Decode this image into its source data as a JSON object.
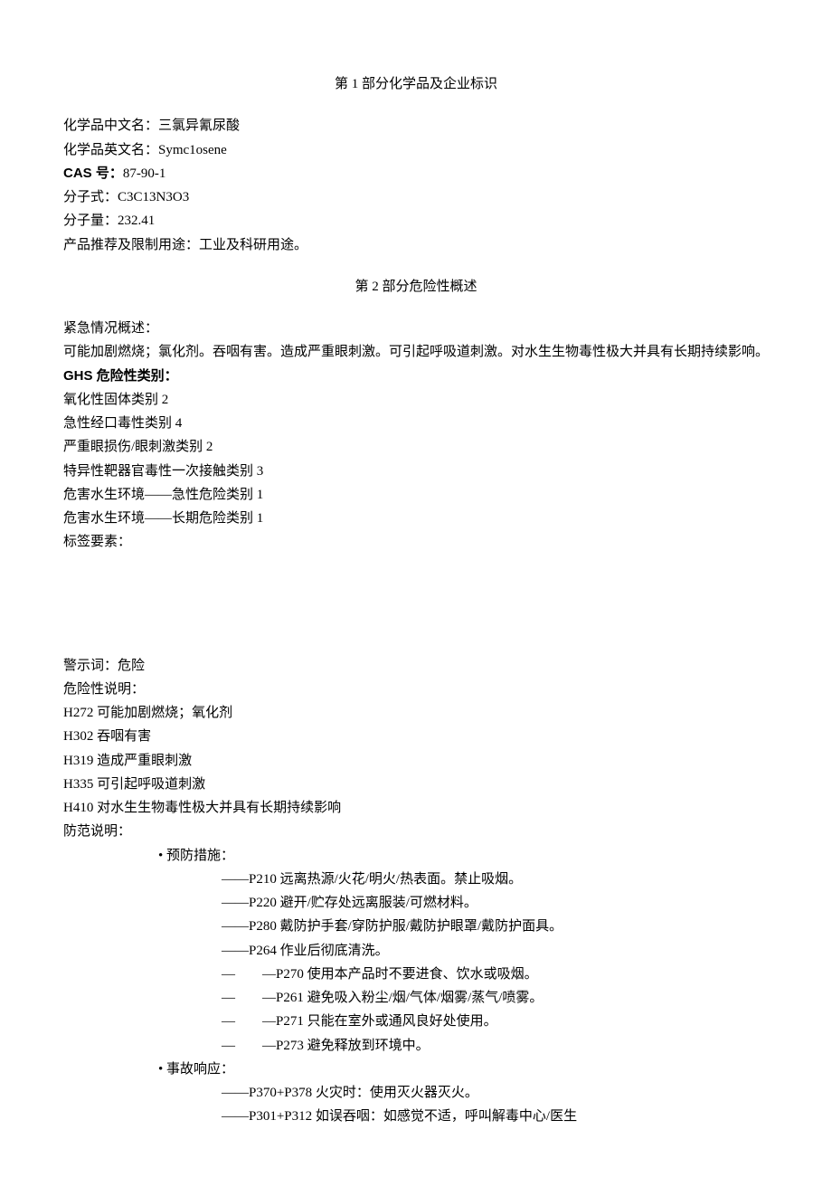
{
  "section1": {
    "header": "第 1 部分化学品及企业标识",
    "rows": [
      {
        "label": "化学品中文名：",
        "value": "三氯异氰尿酸"
      },
      {
        "label": "化学品英文名：",
        "value": "Symc1osene"
      },
      {
        "label": "CAS 号：",
        "value": "87-90-1",
        "boldLabel": true
      },
      {
        "label": "分子式：",
        "value": "C3C13N3O3"
      },
      {
        "label": "分子量：",
        "value": "232.41"
      },
      {
        "label": "产品推荐及限制用途：",
        "value": "工业及科研用途。"
      }
    ]
  },
  "section2": {
    "header": "第 2 部分危险性概述",
    "emergencyLabel": "紧急情况概述：",
    "emergencyText": "可能加剧燃烧；氯化剂。吞咽有害。造成严重眼刺激。可引起呼吸道刺激。对水生生物毒性极大并具有长期持续影响。",
    "ghsLabel": "GHS 危险性类别：",
    "ghsCategories": [
      "氧化性固体类别 2",
      "急性经口毒性类别 4",
      "严重眼损伤/眼刺激类别 2",
      "特异性靶器官毒性一次接触类别 3",
      "危害水生环境——急性危险类别 1",
      "危害水生环境——长期危险类别 1"
    ],
    "labelElements": "标签要素：",
    "signalWordLabel": "警示词：",
    "signalWordValue": "危险",
    "hazardLabel": "危险性说明：",
    "hazardStatements": [
      "H272 可能加剧燃烧；氧化剂",
      "H302 吞咽有害",
      "H319 造成严重眼刺激",
      "H335 可引起呼吸道刺激",
      "H410 对水生生物毒性极大并具有长期持续影响"
    ],
    "precautionLabel": "防范说明：",
    "preventionHeader": "• 预防措施：",
    "preventionItems": [
      "——P210 远离热源/火花/明火/热表面。禁止吸烟。",
      "——P220 避开/贮存处远离服装/可燃材料。",
      "——P280 戴防护手套/穿防护服/戴防护眼罩/戴防护面具。",
      "——P264 作业后彻底清洗。",
      "—　　—P270 使用本产品时不要进食、饮水或吸烟。",
      "—　　—P261 避免吸入粉尘/烟/气体/烟雾/蒸气/喷雾。",
      "—　　—P271 只能在室外或通风良好处使用。",
      "—　　—P273 避免释放到环境中。"
    ],
    "responseHeader": "• 事故响应：",
    "responseItems": [
      "——P370+P378 火灾时：使用灭火器灭火。",
      "——P301+P312 如误吞咽：如感觉不适，呼叫解毒中心/医生"
    ]
  }
}
